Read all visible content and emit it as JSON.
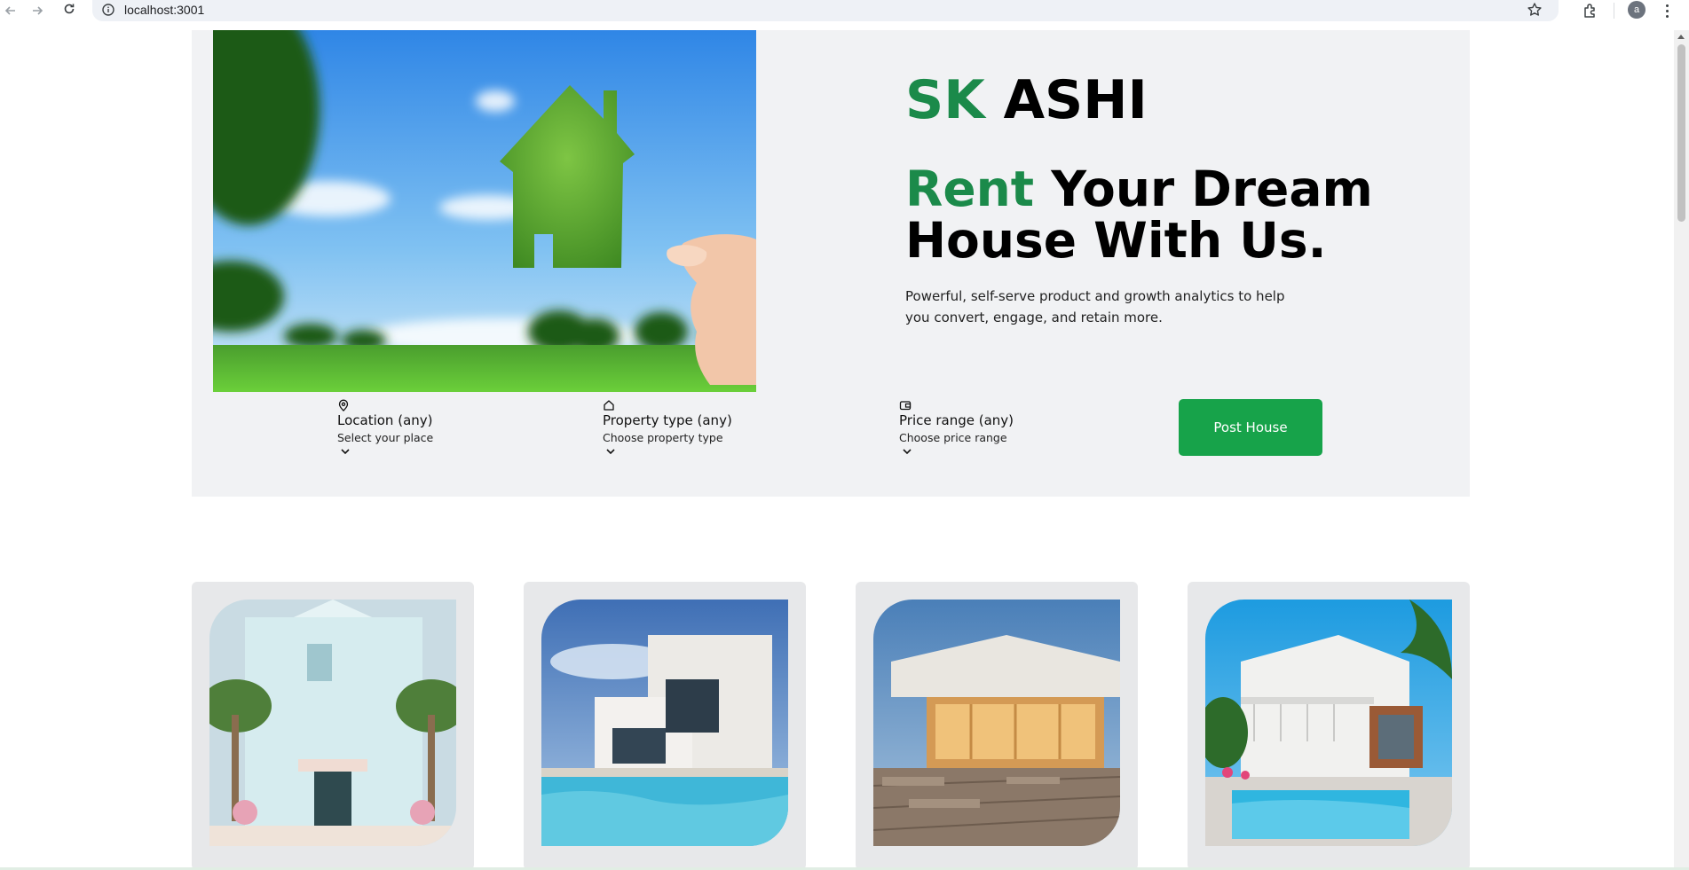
{
  "browser": {
    "url": "localhost:3001",
    "profile_initial": "a",
    "icons": [
      "back-icon",
      "forward-icon",
      "reload-icon",
      "info-icon",
      "star-icon",
      "extensions-icon",
      "menu-icon"
    ]
  },
  "hero": {
    "brand_accent": "SK",
    "brand_rest": "ASHI",
    "headline_accent": "Rent",
    "headline_rest": "Your Dream House With Us.",
    "subtext": "Powerful, self-serve product and growth analytics to help you convert, engage, and retain more.",
    "image": "grass-house-held-in-hand"
  },
  "search": {
    "location": {
      "icon": "map-pin-icon",
      "title": "Location (any)",
      "subtitle": "Select your place"
    },
    "property_type": {
      "icon": "home-icon",
      "title": "Property type (any)",
      "subtitle": "Choose property type"
    },
    "price_range": {
      "icon": "wallet-icon",
      "title": "Price range (any)",
      "subtitle": "Choose price range"
    },
    "post_button": "Post House"
  },
  "listings": [
    {
      "image": "pastel-villa-with-palms"
    },
    {
      "image": "modern-white-house-with-pool"
    },
    {
      "image": "house-with-wooden-deck-at-dusk"
    },
    {
      "image": "white-house-with-pool-and-palm"
    }
  ],
  "colors": {
    "accent_green": "#1b8a4a",
    "button_green": "#17a34a",
    "hero_bg": "#f1f2f4",
    "card_bg": "#e7e8ea"
  }
}
